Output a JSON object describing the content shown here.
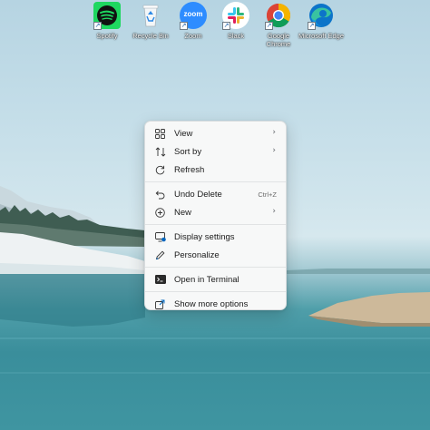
{
  "desktop_icons": [
    {
      "label": "Spotify",
      "icon": "spotify-icon"
    },
    {
      "label": "Recycle Bin",
      "icon": "recycle-bin-icon"
    },
    {
      "label": "Zoom",
      "icon": "zoom-icon"
    },
    {
      "label": "Slack",
      "icon": "slack-icon"
    },
    {
      "label": "Google Chrome",
      "icon": "chrome-icon"
    },
    {
      "label": "Microsoft Edge",
      "icon": "edge-icon"
    }
  ],
  "zoom_logo_text": "zoom",
  "shortcut_arrow": "↗",
  "context_menu": {
    "items": [
      {
        "label": "View",
        "icon": "grid-view-icon",
        "submenu": true
      },
      {
        "label": "Sort by",
        "icon": "sort-icon",
        "submenu": true
      },
      {
        "label": "Refresh",
        "icon": "refresh-icon"
      },
      {
        "label": "Undo Delete",
        "icon": "undo-icon",
        "shortcut": "Ctrl+Z"
      },
      {
        "label": "New",
        "icon": "plus-circle-icon",
        "submenu": true
      },
      {
        "label": "Display settings",
        "icon": "display-icon"
      },
      {
        "label": "Personalize",
        "icon": "pencil-icon"
      },
      {
        "label": "Open in Terminal",
        "icon": "terminal-icon"
      },
      {
        "label": "Show more options",
        "icon": "share-icon"
      }
    ],
    "chevron": "›"
  },
  "colors": {
    "accent": "#0067c0",
    "spotify": "#1ed760",
    "zoom": "#2d8cff",
    "slack_red": "#e01e5a"
  }
}
